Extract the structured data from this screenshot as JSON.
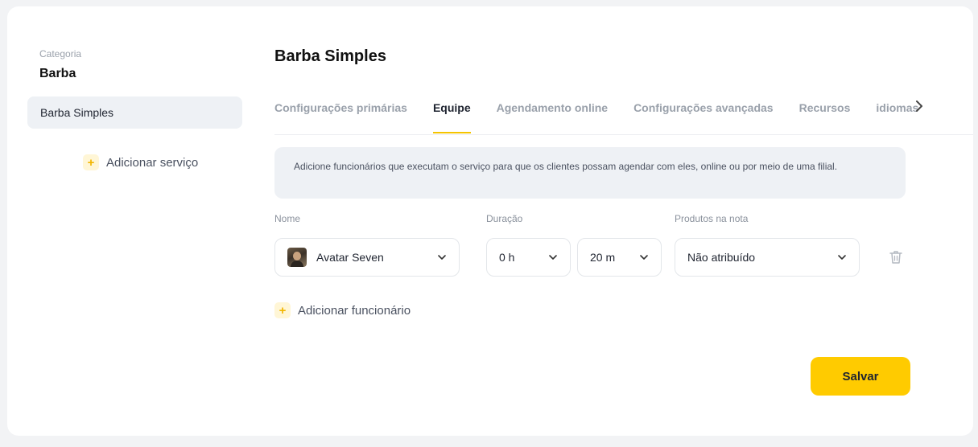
{
  "sidebar": {
    "category_label": "Categoria",
    "category_value": "Barba",
    "services": [
      {
        "label": "Barba Simples"
      }
    ],
    "add_service_label": "Adicionar serviço"
  },
  "main": {
    "title": "Barba Simples",
    "tabs": [
      {
        "label": "Configurações primárias"
      },
      {
        "label": "Equipe",
        "active": true
      },
      {
        "label": "Agendamento online"
      },
      {
        "label": "Configurações avançadas"
      },
      {
        "label": "Recursos"
      },
      {
        "label": "idiomas"
      }
    ],
    "info_text": "Adicione funcionários que executam o serviço para que os clientes possam agendar com eles, online ou por meio de uma filial.",
    "columns": {
      "name": "Nome",
      "duration": "Duração",
      "products": "Produtos na nota"
    },
    "rows": [
      {
        "employee": "Avatar Seven",
        "hours": "0 h",
        "minutes": "20 m",
        "product": "Não atribuído"
      }
    ],
    "add_employee_label": "Adicionar funcionário",
    "save_label": "Salvar"
  },
  "icons": {
    "tab_scroll": "chevron-right-icon",
    "dropdown": "chevron-down-icon",
    "delete": "trash-icon",
    "add": "plus-icon"
  },
  "colors": {
    "accent": "#ffcb00",
    "tab_underline": "#f5c400",
    "plus_bg": "#fff6d6",
    "info_bg": "#eef1f5"
  }
}
